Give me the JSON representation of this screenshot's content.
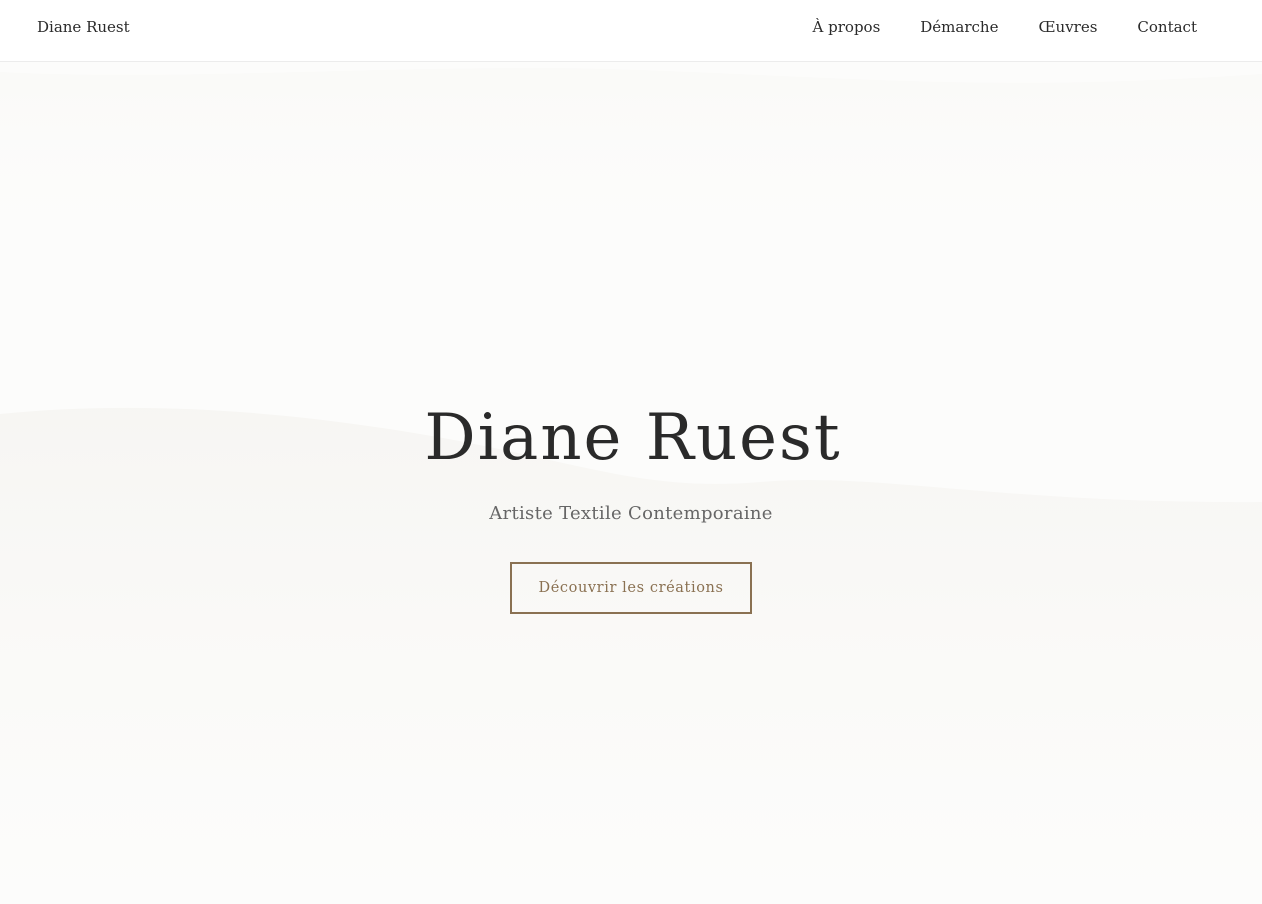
{
  "header": {
    "brand": "Diane Ruest",
    "nav": [
      {
        "label": "À propos"
      },
      {
        "label": "Démarche"
      },
      {
        "label": "Œuvres"
      },
      {
        "label": "Contact"
      }
    ]
  },
  "hero": {
    "title": "Diane Ruest",
    "subtitle": "Artiste Textile Contemporaine",
    "cta_label": "Découvrir les créations"
  },
  "colors": {
    "background": "#fcfcfb",
    "text": "#2a2a2a",
    "accent": "#8a7152"
  }
}
